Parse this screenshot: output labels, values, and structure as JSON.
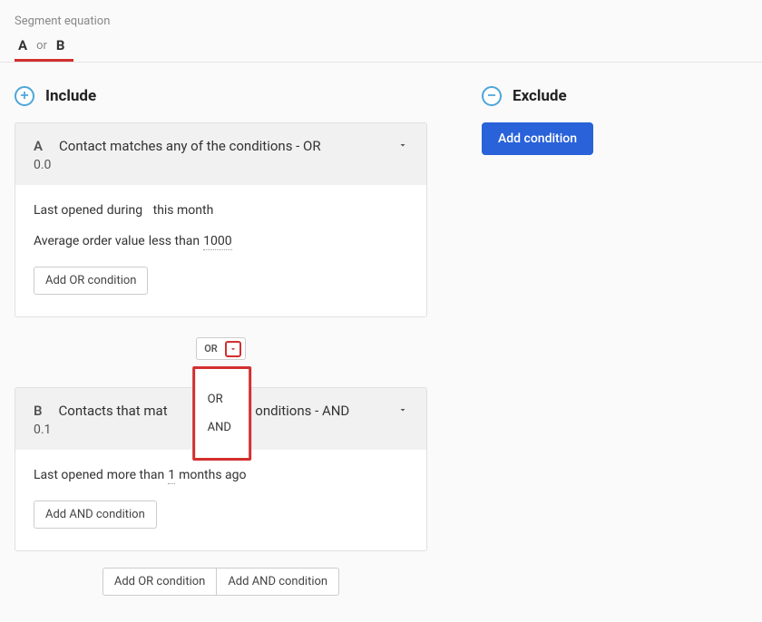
{
  "header": {
    "segment_equation_label": "Segment equation",
    "equation_a": "A",
    "equation_or": "or",
    "equation_b": "B"
  },
  "include": {
    "title": "Include",
    "group_a": {
      "letter": "A",
      "title": "Contact matches any of the conditions - OR",
      "sub": "0.0",
      "condition1": {
        "field": "Last opened",
        "op": "during",
        "value": "this month"
      },
      "condition2": {
        "field": "Average order value",
        "op": "less than",
        "value": "1000"
      },
      "add_btn": "Add OR condition"
    },
    "connector": {
      "label": "OR",
      "option_or": "OR",
      "option_and": "AND"
    },
    "group_b": {
      "letter": "B",
      "title": "Contacts that match all of the conditions - AND",
      "title_visible_left": "Contacts that mat",
      "title_visible_right": "onditions - AND",
      "sub": "0.1",
      "condition1": {
        "field": "Last opened",
        "op": "more than",
        "value": "1",
        "suffix": "months ago"
      },
      "add_btn": "Add AND condition"
    },
    "bottom": {
      "add_or": "Add OR condition",
      "add_and": "Add AND condition"
    }
  },
  "exclude": {
    "title": "Exclude",
    "add_btn": "Add condition"
  }
}
